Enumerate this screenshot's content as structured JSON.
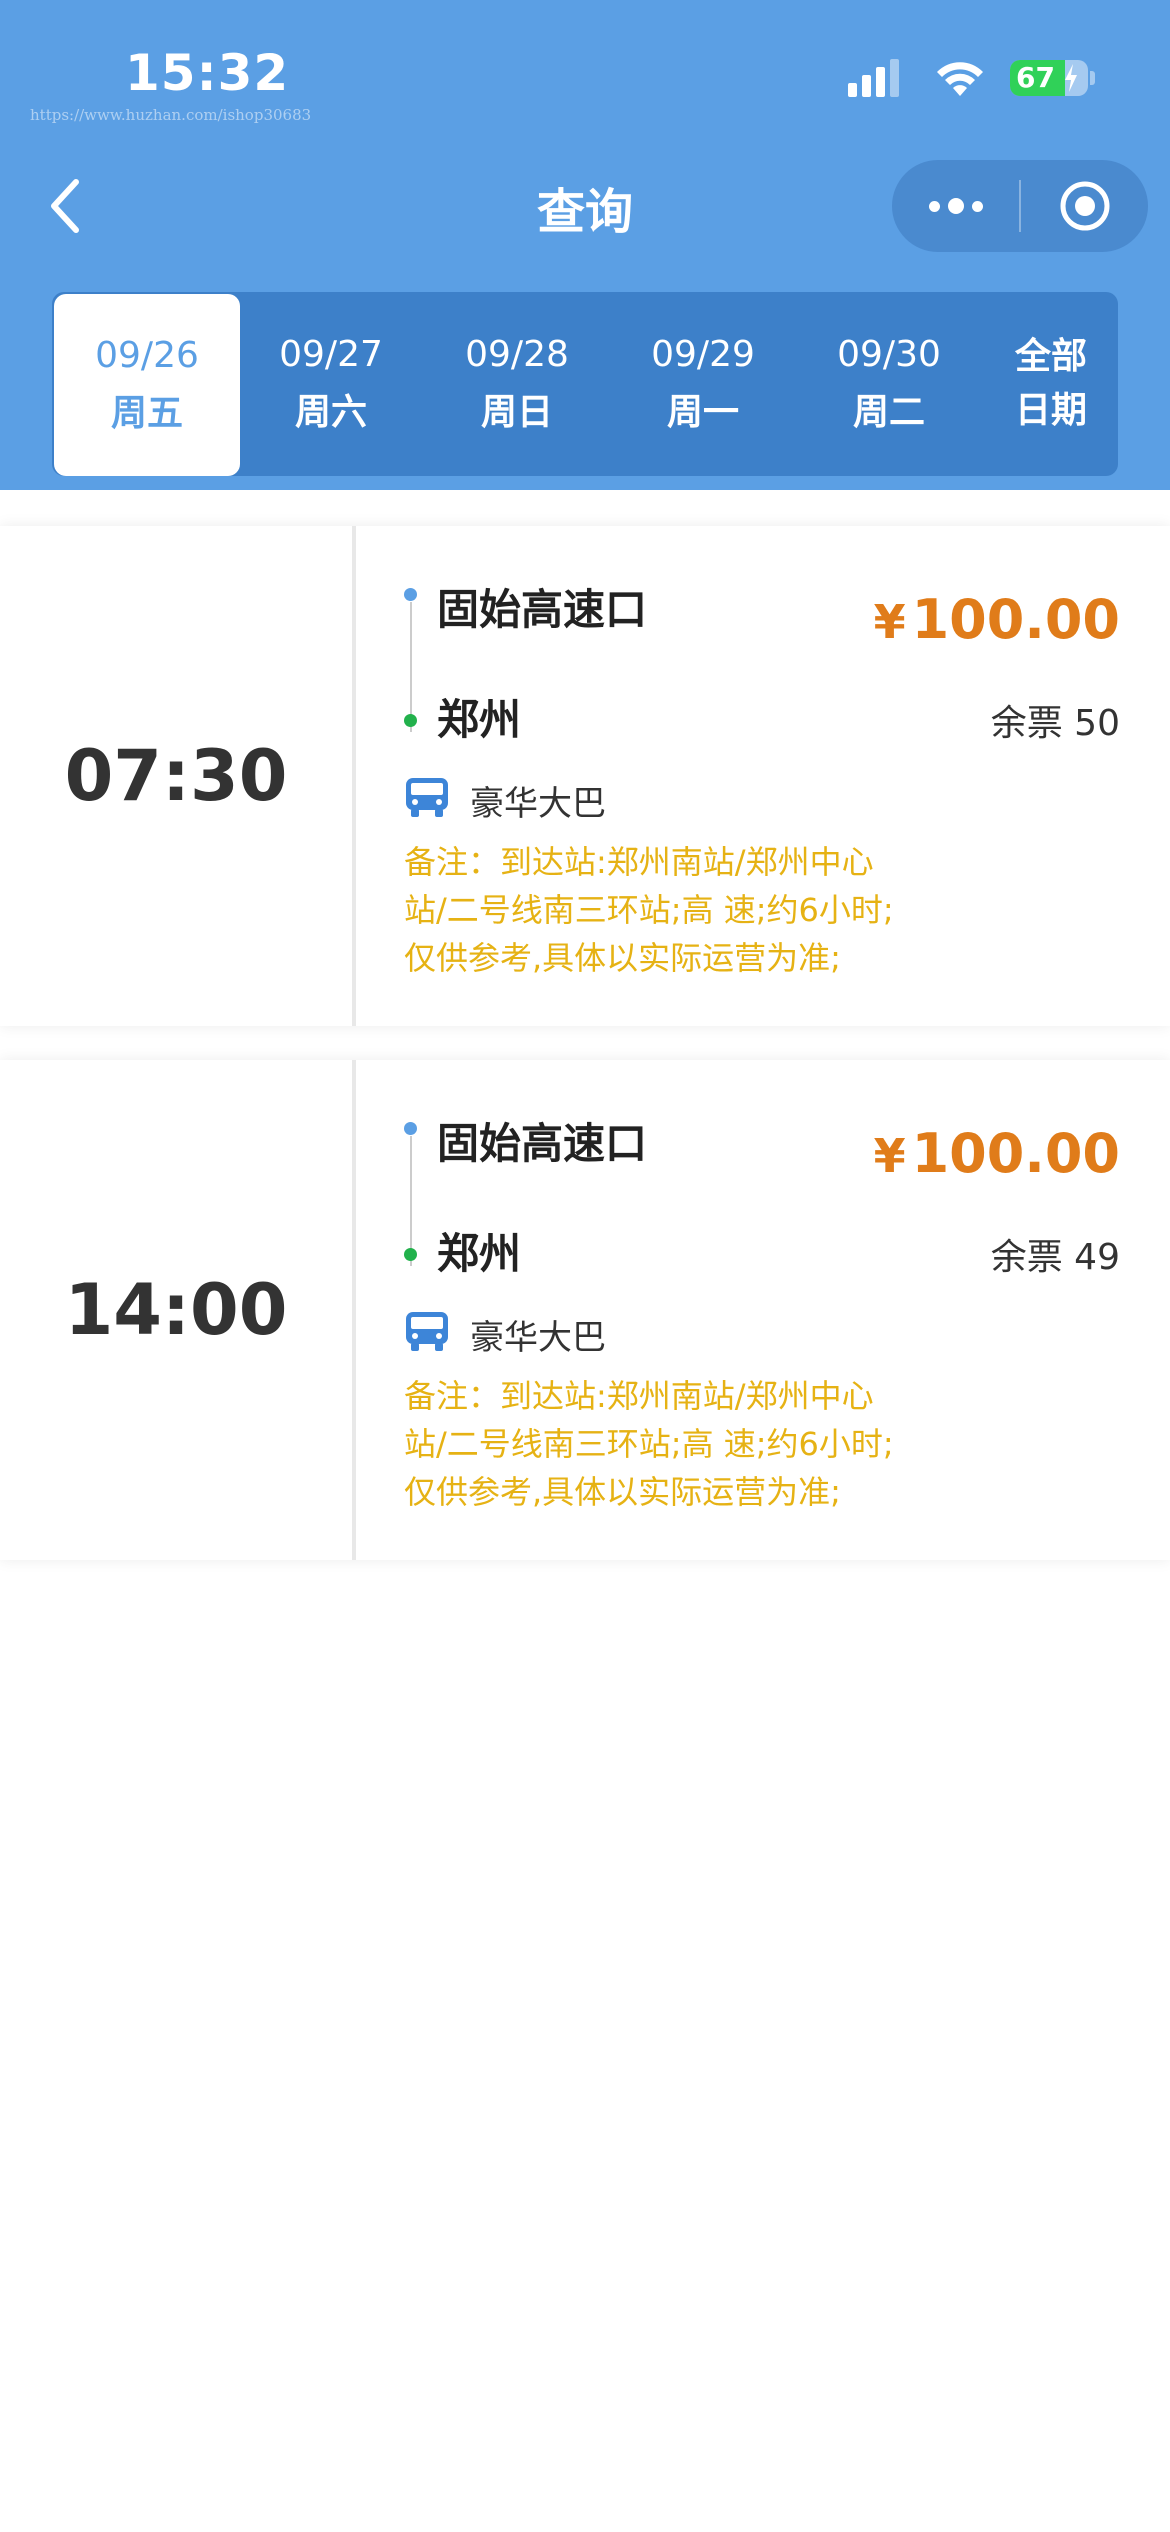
{
  "status_bar": {
    "time": "15:32",
    "watermark": "https://www.huzhan.com/ishop30683",
    "battery": "67"
  },
  "nav": {
    "title": "查询"
  },
  "dates": [
    {
      "date": "09/26",
      "weekday": "周五",
      "active": true
    },
    {
      "date": "09/27",
      "weekday": "周六",
      "active": false
    },
    {
      "date": "09/28",
      "weekday": "周日",
      "active": false
    },
    {
      "date": "09/29",
      "weekday": "周一",
      "active": false
    },
    {
      "date": "09/30",
      "weekday": "周二",
      "active": false
    }
  ],
  "all_dates": {
    "line1": "全部",
    "line2": "日期"
  },
  "trips": [
    {
      "time": "07:30",
      "from": "固始高速口",
      "to": "郑州",
      "currency": "¥",
      "price": "100.00",
      "remaining": "余票 50",
      "bus_type": "豪华大巴",
      "note": "备注：到达站:郑州南站/郑州中心站/二号线南三环站;高 速;约6小时;仅供参考,具体以实际运营为准;"
    },
    {
      "time": "14:00",
      "from": "固始高速口",
      "to": "郑州",
      "currency": "¥",
      "price": "100.00",
      "remaining": "余票 49",
      "bus_type": "豪华大巴",
      "note": "备注：到达站:郑州南站/郑州中心站/二号线南三环站;高 速;约6小时;仅供参考,具体以实际运营为准;"
    }
  ],
  "colors": {
    "header": "#5b9fe4",
    "date_bar": "#3d80c9",
    "price": "#e07c1a",
    "note": "#e6b214",
    "from_dot": "#5b9fe4",
    "to_dot": "#22b14c"
  }
}
